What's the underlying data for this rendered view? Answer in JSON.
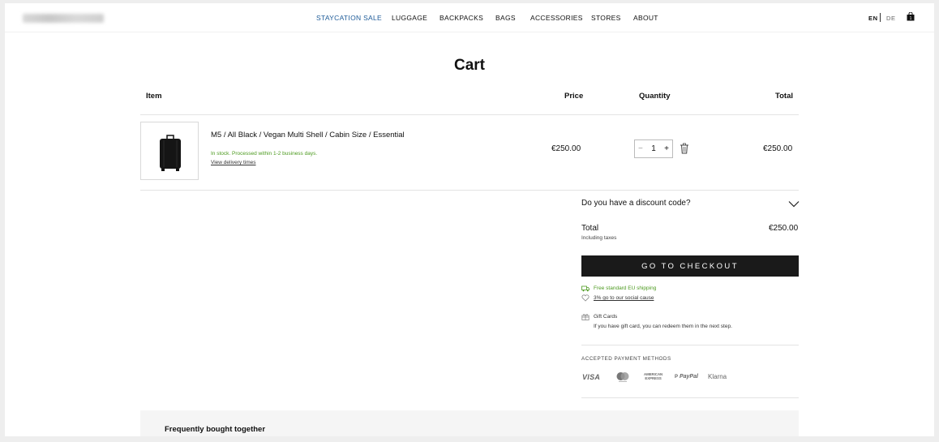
{
  "nav": {
    "items": [
      "STAYCATION SALE",
      "LUGGAGE",
      "BACKPACKS",
      "BAGS",
      "ACCESSORIES",
      "STORES",
      "ABOUT"
    ],
    "languages": [
      "EN",
      "DE"
    ]
  },
  "cart": {
    "title": "Cart",
    "columns": {
      "item": "Item",
      "price": "Price",
      "quantity": "Quantity",
      "total": "Total"
    },
    "line": {
      "name": "M5 / All Black / Vegan Multi Shell / Cabin Size / Essential",
      "stock": "In stock. Processed within 1-2 business days.",
      "delivery_link": "View delivery times",
      "price": "€250.00",
      "quantity": "1",
      "minus": "−",
      "plus": "+",
      "total": "€250.00"
    }
  },
  "summary": {
    "discount_prompt": "Do you have a discount code?",
    "total_label": "Total",
    "total_note": "Including taxes",
    "total_value": "€250.00",
    "checkout_label": "GO TO CHECKOUT",
    "shipping": "Free standard EU shipping",
    "social": "3% go to our social cause",
    "gift_title": "Gift Cards",
    "gift_note": "If you have gift card, you can redeem them in the next step.",
    "payment_title": "ACCEPTED PAYMENT METHODS",
    "payment_methods": {
      "visa": "VISA",
      "amex_1": "AMERICAN",
      "amex_2": "EXPRESS",
      "paypal": "PayPal",
      "klarna": "Klarna"
    }
  },
  "recommendations": {
    "title": "Frequently bought together"
  },
  "colors": {
    "accent_nav": "#1f5c99",
    "success": "#4c9a1f",
    "button": "#1a1a1a"
  },
  "icons": [
    "cart-bag-icon",
    "trash-icon",
    "chevron-down-icon",
    "truck-icon",
    "heart-icon",
    "gift-icon",
    "mastercard-icon"
  ]
}
